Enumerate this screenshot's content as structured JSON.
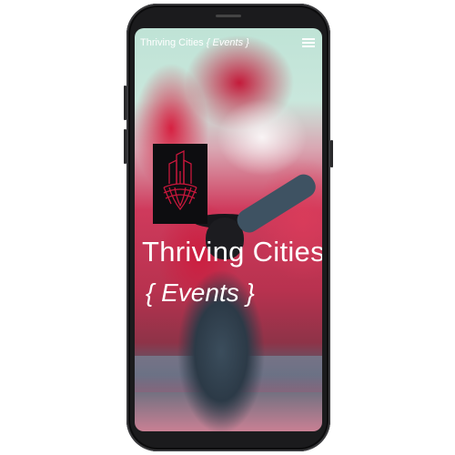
{
  "header": {
    "brand_name": "Thriving Cities",
    "brand_section": "{ Events }",
    "menu_icon": "hamburger-menu-icon"
  },
  "hero": {
    "title": "Thriving Cities",
    "subtitle": "{ Events }",
    "logo_icon": "thriving-cities-logo-icon"
  },
  "colors": {
    "logo_bg": "#0d0d10",
    "logo_stroke": "#c8173c",
    "text": "#ffffff",
    "smoke": "#cf1f45"
  }
}
